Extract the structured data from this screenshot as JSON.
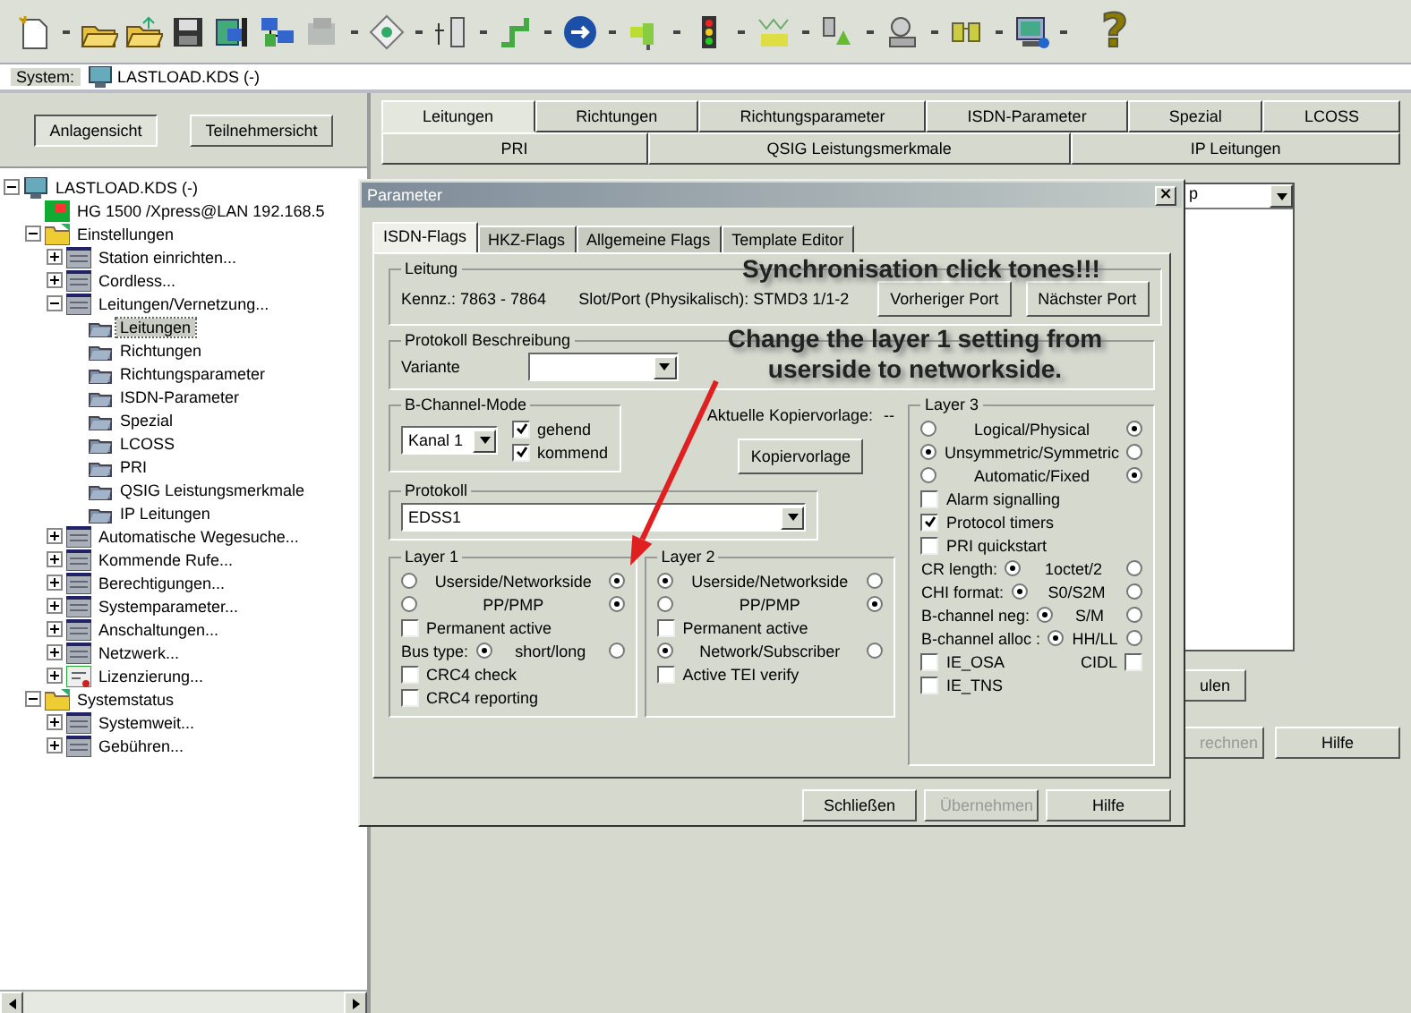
{
  "toolbar": {
    "help_glyph": "?"
  },
  "system_bar": {
    "label": "System:",
    "value": "LASTLOAD.KDS (-)"
  },
  "view_buttons": [
    {
      "label": "Anlagensicht",
      "selected": true
    },
    {
      "label": "Teilnehmersicht",
      "selected": false
    }
  ],
  "tree": [
    {
      "label": "LASTLOAD.KDS (-)",
      "kind": "computer",
      "expanded": true,
      "selected": false,
      "children": [
        {
          "label": "HG 1500 /Xpress@LAN  192.168.5",
          "kind": "device",
          "selected": false
        },
        {
          "label": "Einstellungen",
          "kind": "folder",
          "expanded": true,
          "selected": false,
          "children": [
            {
              "label": "Station einrichten...",
              "kind": "module",
              "expanded": false,
              "selected": false
            },
            {
              "label": "Cordless...",
              "kind": "module",
              "expanded": false,
              "selected": false
            },
            {
              "label": "Leitungen/Vernetzung...",
              "kind": "module",
              "expanded": true,
              "selected": false,
              "children": [
                {
                  "label": "Leitungen",
                  "kind": "leaf",
                  "selected": true
                },
                {
                  "label": "Richtungen",
                  "kind": "leaf",
                  "selected": false
                },
                {
                  "label": "Richtungsparameter",
                  "kind": "leaf",
                  "selected": false
                },
                {
                  "label": "ISDN-Parameter",
                  "kind": "leaf",
                  "selected": false
                },
                {
                  "label": "Spezial",
                  "kind": "leaf",
                  "selected": false
                },
                {
                  "label": "LCOSS",
                  "kind": "leaf",
                  "selected": false
                },
                {
                  "label": "PRI",
                  "kind": "leaf",
                  "selected": false
                },
                {
                  "label": "QSIG Leistungsmerkmale",
                  "kind": "leaf",
                  "selected": false
                },
                {
                  "label": "IP Leitungen",
                  "kind": "leaf",
                  "selected": false
                }
              ]
            },
            {
              "label": "Automatische Wegesuche...",
              "kind": "module",
              "expanded": false,
              "selected": false
            },
            {
              "label": "Kommende Rufe...",
              "kind": "module",
              "expanded": false,
              "selected": false
            },
            {
              "label": "Berechtigungen...",
              "kind": "module",
              "expanded": false,
              "selected": false
            },
            {
              "label": "Systemparameter...",
              "kind": "module",
              "expanded": false,
              "selected": false
            },
            {
              "label": "Anschaltungen...",
              "kind": "module",
              "expanded": false,
              "selected": false
            },
            {
              "label": "Netzwerk...",
              "kind": "module",
              "expanded": false,
              "selected": false
            },
            {
              "label": "Lizenzierung...",
              "kind": "license",
              "expanded": false,
              "selected": false
            }
          ]
        },
        {
          "label": "Systemstatus",
          "kind": "folder",
          "expanded": true,
          "selected": false,
          "children": [
            {
              "label": "Systemweit...",
              "kind": "module",
              "expanded": false,
              "selected": false
            },
            {
              "label": "Gebühren...",
              "kind": "module",
              "expanded": false,
              "selected": false
            }
          ]
        }
      ]
    }
  ],
  "main_tabs": [
    [
      {
        "label": "Leitungen",
        "selected": true
      },
      {
        "label": "Richtungen",
        "selected": false
      },
      {
        "label": "Richtungsparameter",
        "selected": false
      },
      {
        "label": "ISDN-Parameter",
        "selected": false
      },
      {
        "label": "Spezial",
        "selected": false
      },
      {
        "label": "LCOSS",
        "selected": false
      }
    ],
    [
      {
        "label": "PRI",
        "selected": false
      },
      {
        "label": "QSIG Leistungsmerkmale",
        "selected": false
      },
      {
        "label": "IP Leitungen",
        "selected": false
      }
    ]
  ],
  "background_panel": {
    "list_header": "p",
    "buttons": [
      {
        "label": "ulen",
        "disabled": false
      },
      {
        "label": "rechnen",
        "disabled": true
      },
      {
        "label": "Hilfe",
        "disabled": false
      }
    ]
  },
  "dialog": {
    "title": "Parameter",
    "close_glyph": "×",
    "tabs": [
      {
        "label": "ISDN-Flags",
        "selected": true
      },
      {
        "label": "HKZ-Flags",
        "selected": false
      },
      {
        "label": "Allgemeine Flags",
        "selected": false
      },
      {
        "label": "Template Editor",
        "selected": false
      }
    ],
    "leitung": {
      "title": "Leitung",
      "kennz": "Kennz.: 7863 - 7864",
      "slot": "Slot/Port (Physikalisch): STMD3 1/1-2",
      "buttons": [
        "Vorheriger Port",
        "Nächster Port"
      ]
    },
    "beschreibung": {
      "title": "Protokoll Beschreibung",
      "label": "Variante"
    },
    "b_channel": {
      "title": "B-Channel-Mode",
      "value": "Kanal 1",
      "checks": [
        {
          "label": "gehend",
          "checked": true
        },
        {
          "label": "kommend",
          "checked": true
        }
      ]
    },
    "kopiervorlage": {
      "label": "Aktuelle Kopiervorlage:",
      "value": "--",
      "button": "Kopiervorlage"
    },
    "protokoll": {
      "title": "Protokoll",
      "value": "EDSS1"
    },
    "layers": [
      {
        "title": "Layer 1",
        "rows": [
          {
            "kind": "pair",
            "label": "Userside/Networkside",
            "left_selected": false,
            "right_selected": true
          },
          {
            "kind": "pair",
            "label": "PP/PMP",
            "left_selected": false,
            "right_selected": true
          },
          {
            "kind": "check",
            "label": "Permanent active",
            "checked": false
          },
          {
            "kind": "option",
            "label": "Bus type:",
            "value": "short/long",
            "left_selected": true,
            "right_selected": false
          },
          {
            "kind": "check",
            "label": "CRC4 check",
            "checked": false
          },
          {
            "kind": "check",
            "label": "CRC4 reporting",
            "checked": false
          }
        ]
      },
      {
        "title": "Layer 2",
        "rows": [
          {
            "kind": "pair",
            "label": "Userside/Networkside",
            "left_selected": true,
            "right_selected": false
          },
          {
            "kind": "pair",
            "label": "PP/PMP",
            "left_selected": false,
            "right_selected": true
          },
          {
            "kind": "check",
            "label": "Permanent active",
            "checked": false
          },
          {
            "kind": "pair",
            "label": "Network/Subscriber",
            "left_selected": true,
            "right_selected": false
          },
          {
            "kind": "check",
            "label": "Active TEI verify",
            "checked": false
          }
        ]
      },
      {
        "title": "Layer 3",
        "rows": [
          {
            "kind": "pair",
            "label": "Logical/Physical",
            "left_selected": false,
            "right_selected": true
          },
          {
            "kind": "pair",
            "label": "Unsymmetric/Symmetric",
            "left_selected": true,
            "right_selected": false
          },
          {
            "kind": "pair",
            "label": "Automatic/Fixed",
            "left_selected": false,
            "right_selected": true
          },
          {
            "kind": "check",
            "label": "Alarm signalling",
            "checked": false
          },
          {
            "kind": "check",
            "label": "Protocol timers",
            "checked": true
          },
          {
            "kind": "check",
            "label": "PRI quickstart",
            "checked": false
          },
          {
            "kind": "option",
            "label": "CR length:",
            "value": "1octet/2",
            "left_selected": true,
            "right_selected": false
          },
          {
            "kind": "option",
            "label": "CHI format:",
            "value": "S0/S2M",
            "left_selected": true,
            "right_selected": false
          },
          {
            "kind": "option",
            "label": "B-channel neg:",
            "value": "S/M",
            "left_selected": true,
            "right_selected": false
          },
          {
            "kind": "option",
            "label": "B-channel alloc :",
            "value": "HH/LL",
            "left_selected": true,
            "right_selected": false
          },
          {
            "kind": "check_pair",
            "label": "IE_OSA",
            "checked": false,
            "label2": "CIDL",
            "checked2": false
          },
          {
            "kind": "check",
            "label": "IE_TNS",
            "checked": false
          }
        ]
      }
    ],
    "buttons": [
      {
        "label": "Schließen",
        "disabled": false
      },
      {
        "label": "Übernehmen",
        "disabled": true
      },
      {
        "label": "Hilfe",
        "disabled": false
      }
    ]
  },
  "annotations": [
    {
      "text": "Synchronisation click tones!!!"
    },
    {
      "text": "Change the layer 1 setting from userside to networkside."
    }
  ]
}
